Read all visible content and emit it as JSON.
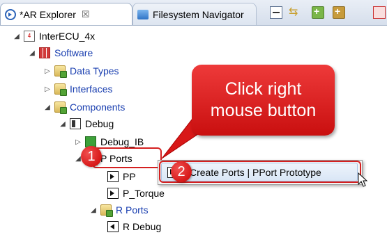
{
  "tabs": [
    {
      "label": "*AR Explorer",
      "close": "☒",
      "active": true
    },
    {
      "label": "Filesystem Navigator",
      "active": false
    }
  ],
  "tree": {
    "root": "InterECU_4x",
    "software": "Software",
    "data_types": "Data Types",
    "interfaces": "Interfaces",
    "components": "Components",
    "debug": "Debug",
    "debug_ib": "Debug_IB",
    "p_ports": "P Ports",
    "pp": "PP",
    "p_torque": "P_Torque",
    "r_ports": "R Ports",
    "r_debug": "R Debug"
  },
  "callout": {
    "text": "Click right\nmouse button"
  },
  "steps": {
    "one": "1",
    "two": "2"
  },
  "context_menu": {
    "item": "Create Ports | PPort Prototype"
  },
  "colors": {
    "highlight": "#d42020",
    "callout": "#e02020",
    "link": "#1a3fb0"
  },
  "icons": [
    "ar-explorer-icon",
    "filesystem-icon",
    "collapse-all-icon",
    "link-editor-icon",
    "add-icon",
    "add-alt-icon",
    "filter-icon"
  ]
}
